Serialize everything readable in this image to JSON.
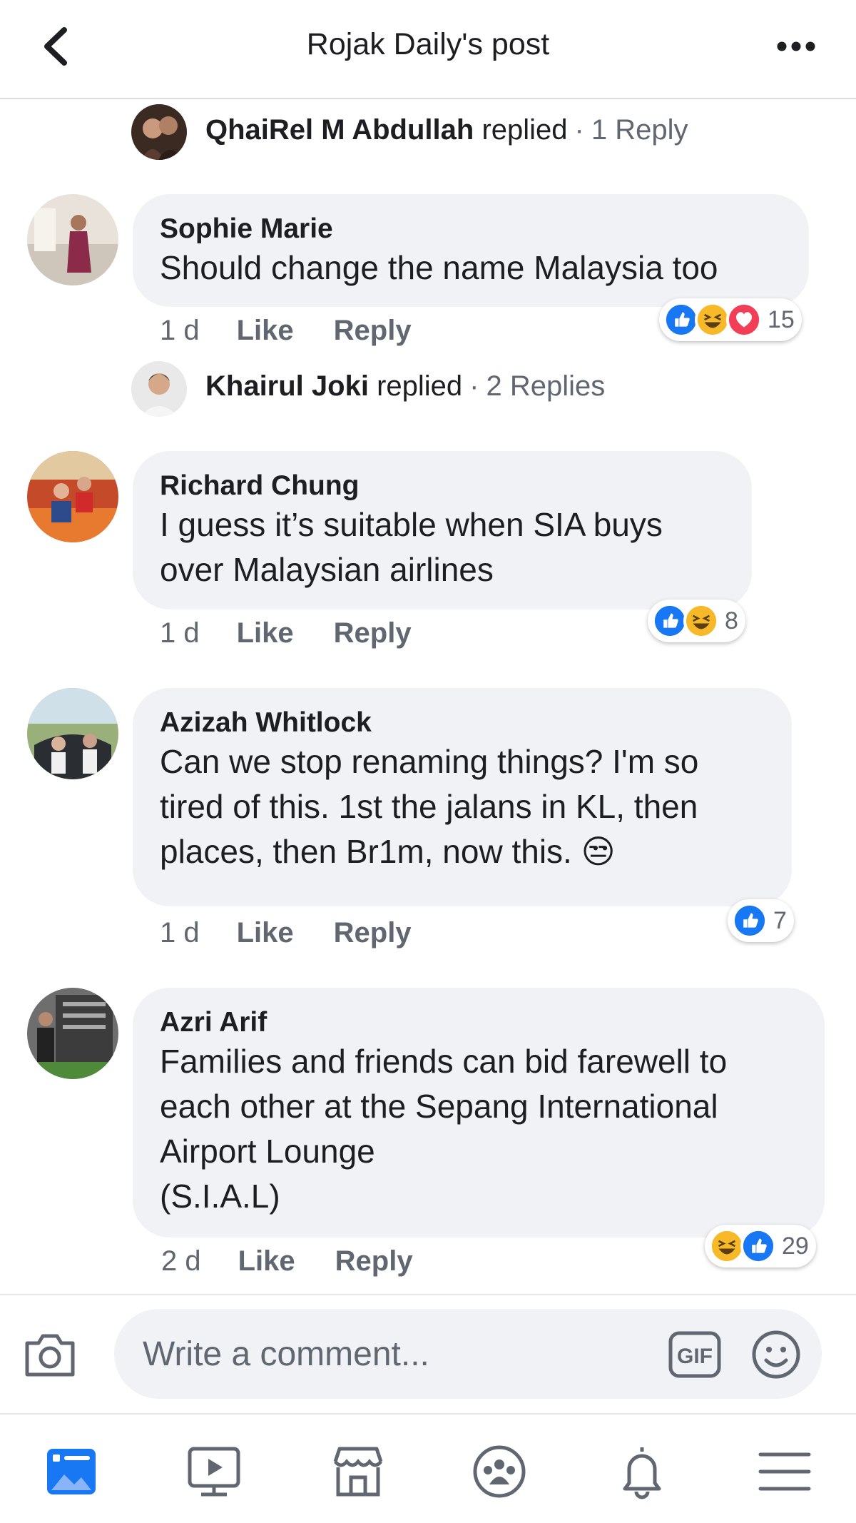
{
  "header": {
    "title": "Rojak Daily's post",
    "back_icon": "chevron-left-icon",
    "more_icon": "more-dots-icon"
  },
  "reply_summaries": [
    {
      "name": "QhaiRel M Abdullah",
      "verb": "replied",
      "separator": "·",
      "count": "1 Reply"
    },
    {
      "name": "Khairul Joki",
      "verb": "replied",
      "separator": "·",
      "count": "2 Replies"
    }
  ],
  "comments": [
    {
      "author": "Sophie Marie",
      "text": "Should change the name Malaysia too",
      "time": "1 d",
      "like": "Like",
      "reply": "Reply",
      "reactions": [
        "like",
        "haha",
        "love"
      ],
      "reaction_count": "15"
    },
    {
      "author": "Richard Chung",
      "text": "I guess it’s suitable when SIA buys\nover Malaysian airlines",
      "time": "1 d",
      "like": "Like",
      "reply": "Reply",
      "reactions": [
        "like",
        "haha"
      ],
      "reaction_count": "8"
    },
    {
      "author": "Azizah Whitlock",
      "text": "Can we stop renaming things? I'm so\ntired of this. 1st the jalans in KL, then\nplaces, then Br1m, now this. 😒",
      "time": "1 d",
      "like": "Like",
      "reply": "Reply",
      "reactions": [
        "like"
      ],
      "reaction_count": "7"
    },
    {
      "author": "Azri Arif",
      "text": "Families and friends can bid farewell to\neach other at the Sepang International\nAirport Lounge\n(S.I.A.L)",
      "time": "2 d",
      "like": "Like",
      "reply": "Reply",
      "reactions": [
        "haha",
        "like"
      ],
      "reaction_count": "29"
    }
  ],
  "composer": {
    "placeholder": "Write a comment...",
    "camera_icon": "camera-icon",
    "gif_icon": "gif-icon",
    "emoji_icon": "emoji-icon"
  },
  "bottom_nav": [
    "news-feed-icon",
    "watch-icon",
    "marketplace-icon",
    "groups-icon",
    "notifications-icon",
    "menu-icon"
  ],
  "colors": {
    "like_blue": "#1877f2",
    "love_red": "#f33e58",
    "haha_yellow": "#f7b928",
    "bubble_gray": "#f0f2f5",
    "meta_gray": "#606770",
    "active_nav_blue": "#1877f2"
  }
}
